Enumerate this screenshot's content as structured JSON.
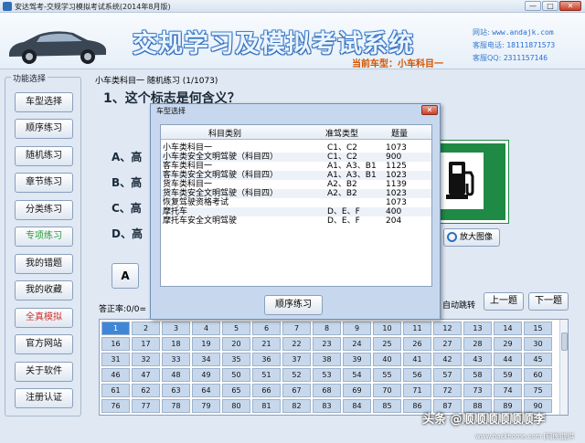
{
  "window": {
    "title": "安达驾考-交规学习模拟考试系统(2014年8月版)",
    "min": "—",
    "max": "□",
    "close": "✕"
  },
  "header": {
    "title": "交规学习及模拟考试系统",
    "current_car": "当前车型：小车科目一",
    "website_label": "网站:",
    "website": "www.andajk.com",
    "phone_label": "客服电话:",
    "phone": "18111871573",
    "qq_label": "客服QQ:",
    "qq": "2311157146"
  },
  "sidebar": {
    "legend": "功能选择",
    "items": [
      {
        "label": "车型选择"
      },
      {
        "label": "顺序练习"
      },
      {
        "label": "随机练习"
      },
      {
        "label": "章节练习"
      },
      {
        "label": "分类练习"
      },
      {
        "label": "专项练习"
      },
      {
        "label": "我的错题"
      },
      {
        "label": "我的收藏"
      },
      {
        "label": "全真模拟"
      },
      {
        "label": "官方网站"
      },
      {
        "label": "关于软件"
      },
      {
        "label": "注册认证"
      }
    ]
  },
  "exam": {
    "subject_line": "小车类科目一  随机练习 (1/1073)",
    "question": "1、这个标志是何含义？",
    "options": [
      "A、高",
      "B、高",
      "C、高",
      "D、高"
    ],
    "answer_button": "A",
    "zoom_label": "放大图像",
    "accuracy": "答正率:0/0=",
    "auto_jump": "自动跳转",
    "prev": "上一题",
    "next": "下一题",
    "current_number": "1",
    "numbers": [
      [
        1,
        2,
        3,
        4,
        5,
        6,
        7,
        8,
        9,
        10,
        11,
        12,
        13,
        14,
        15
      ],
      [
        16,
        17,
        18,
        19,
        20,
        21,
        22,
        23,
        24,
        25,
        26,
        27,
        28,
        29,
        30
      ],
      [
        31,
        32,
        33,
        34,
        35,
        36,
        37,
        38,
        39,
        40,
        41,
        42,
        43,
        44,
        45
      ],
      [
        46,
        47,
        48,
        49,
        50,
        51,
        52,
        53,
        54,
        55,
        56,
        57,
        58,
        59,
        60
      ],
      [
        61,
        62,
        63,
        64,
        65,
        66,
        67,
        68,
        69,
        70,
        71,
        72,
        73,
        74,
        75
      ],
      [
        76,
        77,
        78,
        79,
        80,
        81,
        82,
        83,
        84,
        85,
        86,
        87,
        88,
        89,
        90
      ]
    ]
  },
  "dialog": {
    "title": "车型选择",
    "close": "✕",
    "headers": [
      "科目类别",
      "准驾类型",
      "题量"
    ],
    "rows": [
      {
        "subject": "小车类科目一",
        "license": "C1、C2",
        "count": "1073"
      },
      {
        "subject": "小车类安全文明驾驶（科目四）",
        "license": "C1、C2",
        "count": "900"
      },
      {
        "subject": "客车类科目一",
        "license": "A1、A3、B1",
        "count": "1125"
      },
      {
        "subject": "客车类安全文明驾驶（科目四）",
        "license": "A1、A3、B1",
        "count": "1023"
      },
      {
        "subject": "货车类科目一",
        "license": "A2、B2",
        "count": "1139"
      },
      {
        "subject": "货车类安全文明驾驶（科目四）",
        "license": "A2、B2",
        "count": "1023"
      },
      {
        "subject": "恢复驾驶资格考试",
        "license": "",
        "count": "1073"
      },
      {
        "subject": "摩托车",
        "license": "D、E、F",
        "count": "400"
      },
      {
        "subject": "摩托车安全文明驾驶",
        "license": "D、E、F",
        "count": "204"
      }
    ],
    "button": "顺序练习"
  },
  "watermark": {
    "text": "头条 @顺顺顺顺顺顺李",
    "url": "www.hackhome.com [网侠]提供"
  },
  "colors": {
    "sign_green": "#1f8a45",
    "title_blue": "#3b78c4",
    "accent_orange": "#d35400"
  }
}
